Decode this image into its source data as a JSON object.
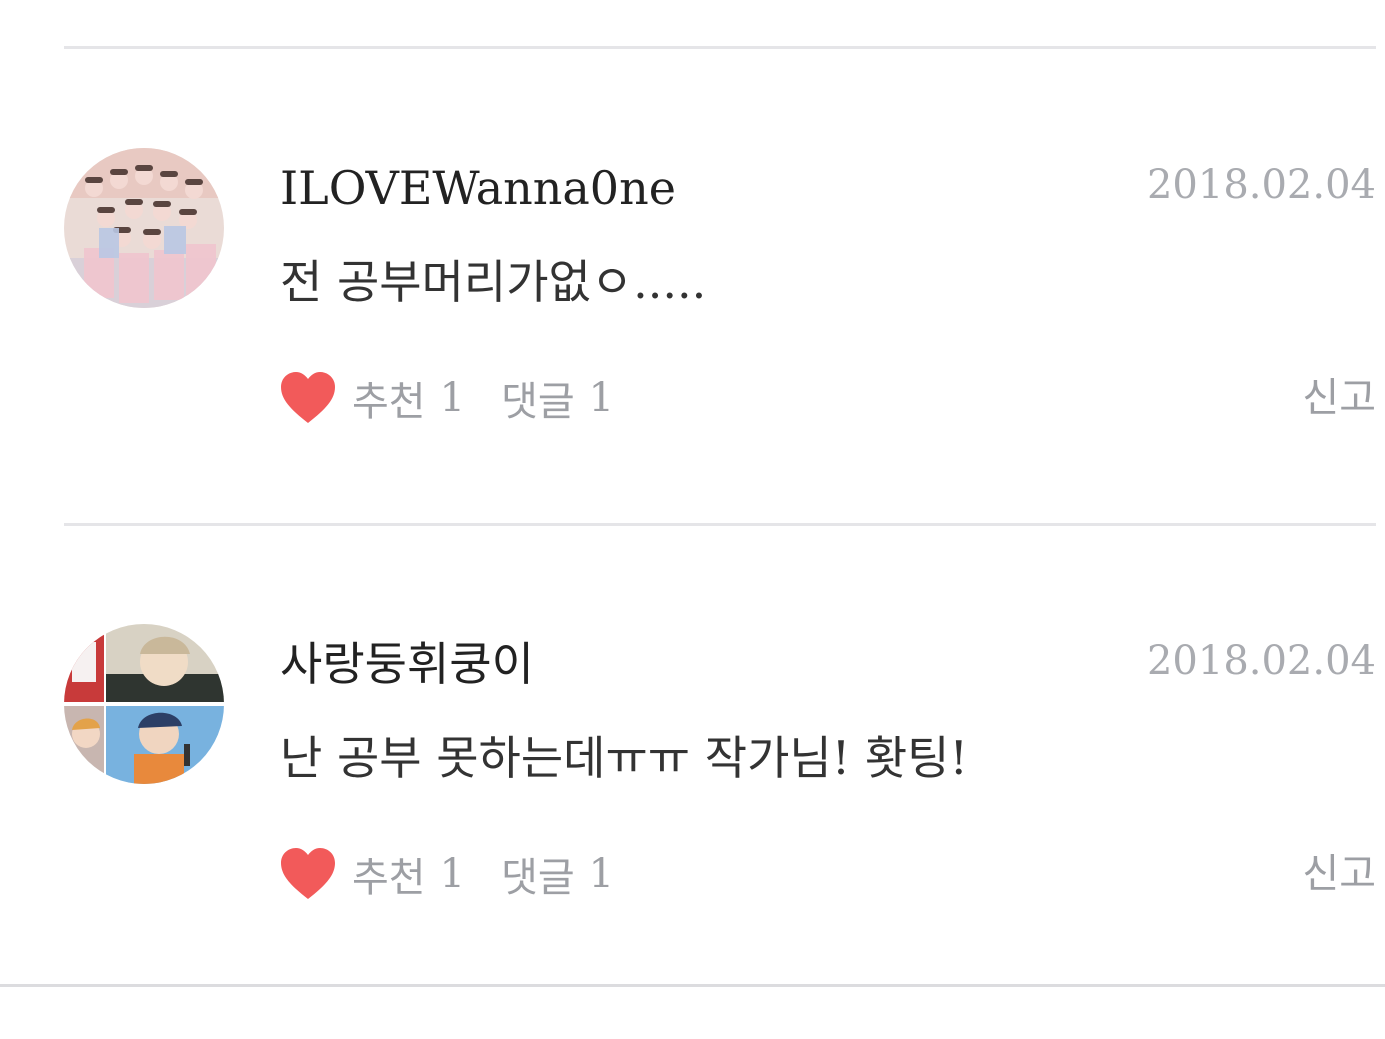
{
  "colors": {
    "heart": "#f25a5a",
    "meta_text": "#9d9fa4",
    "date_text": "#a9abb0",
    "divider": "#e5e5e8"
  },
  "comments": [
    {
      "username": "ILOVEWanna0ne",
      "date": "2018.02.04",
      "text": "전 공부머리가없ㅇ.....",
      "like_label": "추천",
      "like_count": "1",
      "reply_label": "댓글",
      "reply_count": "1",
      "report_label": "신고",
      "icon": "heart-icon"
    },
    {
      "username": "사랑둥휘쿵이",
      "date": "2018.02.04",
      "text": "난 공부 못하는데ㅠㅠ 작가님! 홧팅!",
      "like_label": "추천",
      "like_count": "1",
      "reply_label": "댓글",
      "reply_count": "1",
      "report_label": "신고",
      "icon": "heart-icon"
    }
  ]
}
